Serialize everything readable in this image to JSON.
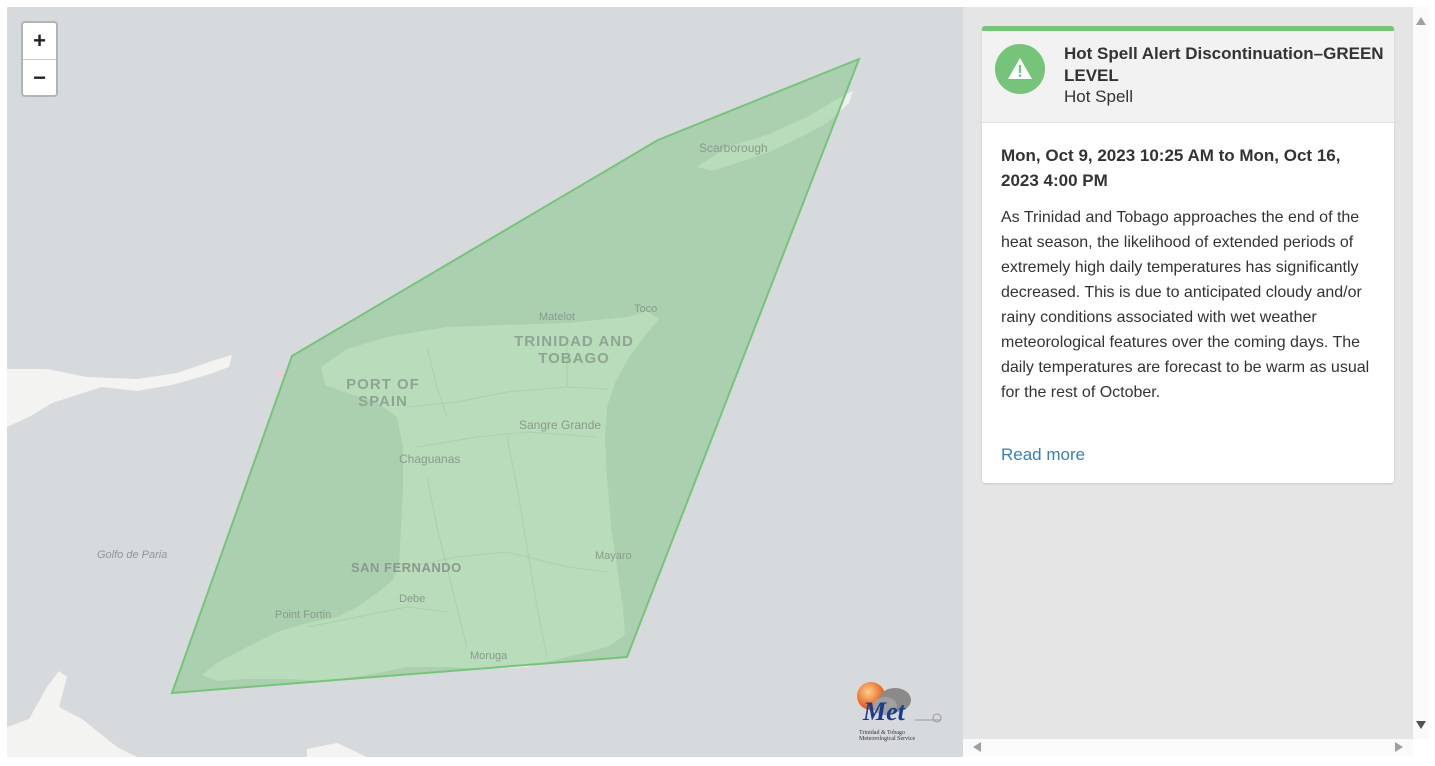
{
  "map": {
    "zoom_in_label": "+",
    "zoom_out_label": "−",
    "labels": {
      "scarborough": "Scarborough",
      "matelot": "Matelot",
      "toco": "Toco",
      "country_line1": "TRINIDAD AND",
      "country_line2": "TOBAGO",
      "pos_line1": "PORT OF",
      "pos_line2": "SPAIN",
      "sangre_grande": "Sangre Grande",
      "chaguanas": "Chaguanas",
      "gulf": "Golfo de Paria",
      "mayaro": "Mayaro",
      "san_fernando": "SAN FERNANDO",
      "debe": "Debe",
      "point_fortin": "Point Fortin",
      "moruga": "Moruga"
    },
    "alert_area_color": "#76c47a",
    "logo": {
      "name": "Met",
      "caption_line1": "Trinidad & Tobago",
      "caption_line2": "Meteorological Service"
    }
  },
  "alert": {
    "icon": "warning-icon",
    "title": "Hot Spell Alert Discontinuation–GREEN LEVEL",
    "category": "Hot Spell",
    "level_color": "#76c47a",
    "dates": "Mon, Oct 9, 2023 10:25 AM to Mon, Oct 16, 2023 4:00 PM",
    "description": "As Trinidad and Tobago approaches the end of the heat season, the likelihood of extended periods of extremely high daily temperatures has significantly decreased. This is due to anticipated cloudy and/or rainy conditions associated with wet weather meteorological features over the coming days. The daily temperatures are forecast to be warm as usual for the rest of October.",
    "read_more": "Read more"
  }
}
